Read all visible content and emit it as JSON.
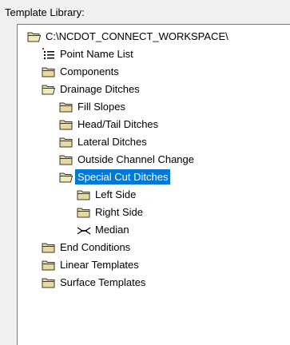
{
  "label": "Template Library:",
  "tree": {
    "root": "C:\\NCDOT_CONNECT_WORKSPACE\\",
    "point_name_list": "Point Name List",
    "components": "Components",
    "drainage_ditches": "Drainage Ditches",
    "fill_slopes": "Fill Slopes",
    "head_tail_ditches": "Head/Tail Ditches",
    "lateral_ditches": "Lateral Ditches",
    "outside_channel_change": "Outside Channel Change",
    "special_cut_ditches": "Special Cut Ditches",
    "left_side": "Left Side",
    "right_side": "Right Side",
    "median": "Median",
    "end_conditions": "End Conditions",
    "linear_templates": "Linear Templates",
    "surface_templates": "Surface Templates"
  },
  "selected_item": "Special Cut Ditches",
  "colors": {
    "selection": "#0078d7",
    "folder": "#e8d9a0",
    "folder_outline": "#3a3a2a"
  }
}
